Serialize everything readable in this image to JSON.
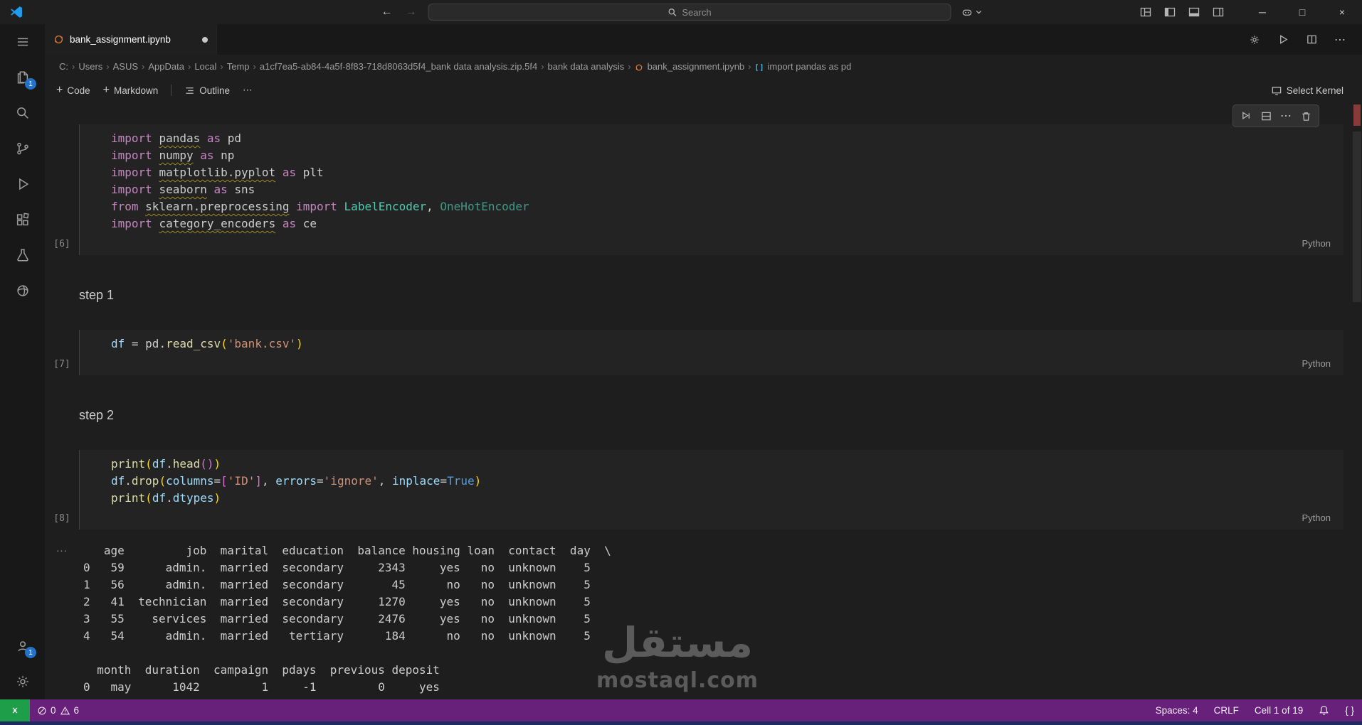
{
  "colors": {
    "statusbar": "#68217a",
    "remote": "#1f9e4a",
    "badge": "#2472c8",
    "taskstrip": "#1e2b5e"
  },
  "icons": {
    "plus": "+",
    "ellipsis": "⋯",
    "dot": "●",
    "minimize": "─",
    "maximize": "□",
    "close": "×",
    "back": "←",
    "forward": "→",
    "output_collapse": "...",
    "braces": "{ }"
  },
  "titlebar": {
    "search": "Search"
  },
  "tab": {
    "label": "bank_assignment.ipynb"
  },
  "breadcrumbs": [
    "C:",
    "Users",
    "ASUS",
    "AppData",
    "Local",
    "Temp",
    "a1cf7ea5-ab84-4a5f-8f83-718d8063d5f4_bank data analysis.zip.5f4",
    "bank data analysis",
    "bank_assignment.ipynb",
    "import pandas as pd"
  ],
  "notebook_toolbar": {
    "add_code": "Code",
    "add_markdown": "Markdown",
    "outline": "Outline",
    "select_kernel": "Select Kernel"
  },
  "activitybar": {
    "explorer_badge": "1",
    "accounts_badge": "1"
  },
  "notebook": {
    "cells": [
      {
        "type": "code",
        "exec": "[6]",
        "lang": "Python",
        "lines": [
          [
            {
              "t": "import",
              "c": "kw"
            },
            {
              "t": " ",
              "c": "pl"
            },
            {
              "t": "pandas",
              "c": "pl sq"
            },
            {
              "t": " ",
              "c": "pl"
            },
            {
              "t": "as",
              "c": "kw"
            },
            {
              "t": " pd",
              "c": "pl"
            }
          ],
          [
            {
              "t": "import",
              "c": "kw"
            },
            {
              "t": " ",
              "c": "pl"
            },
            {
              "t": "numpy",
              "c": "pl sq"
            },
            {
              "t": " ",
              "c": "pl"
            },
            {
              "t": "as",
              "c": "kw"
            },
            {
              "t": " np",
              "c": "pl"
            }
          ],
          [
            {
              "t": "import",
              "c": "kw"
            },
            {
              "t": " ",
              "c": "pl"
            },
            {
              "t": "matplotlib.pyplot",
              "c": "pl sq"
            },
            {
              "t": " ",
              "c": "pl"
            },
            {
              "t": "as",
              "c": "kw"
            },
            {
              "t": " plt",
              "c": "pl"
            }
          ],
          [
            {
              "t": "import",
              "c": "kw"
            },
            {
              "t": " ",
              "c": "pl"
            },
            {
              "t": "seaborn",
              "c": "pl sq"
            },
            {
              "t": " ",
              "c": "pl"
            },
            {
              "t": "as",
              "c": "kw"
            },
            {
              "t": " sns",
              "c": "pl"
            }
          ],
          [
            {
              "t": "from",
              "c": "kw"
            },
            {
              "t": " ",
              "c": "pl"
            },
            {
              "t": "sklearn.preprocessing",
              "c": "pl sq"
            },
            {
              "t": " ",
              "c": "pl"
            },
            {
              "t": "import",
              "c": "kw"
            },
            {
              "t": " ",
              "c": "pl"
            },
            {
              "t": "LabelEncoder",
              "c": "cls"
            },
            {
              "t": ", ",
              "c": "pl"
            },
            {
              "t": "OneHotEncoder",
              "c": "cls dim"
            }
          ],
          [
            {
              "t": "import",
              "c": "kw"
            },
            {
              "t": " ",
              "c": "pl"
            },
            {
              "t": "category_encoders",
              "c": "pl sq"
            },
            {
              "t": " ",
              "c": "pl"
            },
            {
              "t": "as",
              "c": "kw"
            },
            {
              "t": " ce",
              "c": "pl"
            }
          ]
        ]
      },
      {
        "type": "markdown",
        "text": "step 1"
      },
      {
        "type": "code",
        "exec": "[7]",
        "lang": "Python",
        "lines": [
          [
            {
              "t": "df",
              "c": "var"
            },
            {
              "t": " = ",
              "c": "pl"
            },
            {
              "t": "pd",
              "c": "pl"
            },
            {
              "t": ".",
              "c": "pl"
            },
            {
              "t": "read_csv",
              "c": "fn"
            },
            {
              "t": "(",
              "c": "b1"
            },
            {
              "t": "'bank.csv'",
              "c": "str"
            },
            {
              "t": ")",
              "c": "b1"
            }
          ]
        ]
      },
      {
        "type": "markdown",
        "text": "step 2"
      },
      {
        "type": "code",
        "exec": "[8]",
        "lang": "Python",
        "lines": [
          [
            {
              "t": "print",
              "c": "fn"
            },
            {
              "t": "(",
              "c": "b1"
            },
            {
              "t": "df",
              "c": "var"
            },
            {
              "t": ".",
              "c": "pl"
            },
            {
              "t": "head",
              "c": "fn"
            },
            {
              "t": "(",
              "c": "b2"
            },
            {
              "t": ")",
              "c": "b2"
            },
            {
              "t": ")",
              "c": "b1"
            }
          ],
          [
            {
              "t": "df",
              "c": "var"
            },
            {
              "t": ".",
              "c": "pl"
            },
            {
              "t": "drop",
              "c": "fn"
            },
            {
              "t": "(",
              "c": "b1"
            },
            {
              "t": "columns",
              "c": "param"
            },
            {
              "t": "=",
              "c": "pl"
            },
            {
              "t": "[",
              "c": "b2"
            },
            {
              "t": "'ID'",
              "c": "str"
            },
            {
              "t": "]",
              "c": "b2"
            },
            {
              "t": ", ",
              "c": "pl"
            },
            {
              "t": "errors",
              "c": "param"
            },
            {
              "t": "=",
              "c": "pl"
            },
            {
              "t": "'ignore'",
              "c": "str"
            },
            {
              "t": ", ",
              "c": "pl"
            },
            {
              "t": "inplace",
              "c": "param"
            },
            {
              "t": "=",
              "c": "pl"
            },
            {
              "t": "True",
              "c": "kb"
            },
            {
              "t": ")",
              "c": "b1"
            }
          ],
          [
            {
              "t": "print",
              "c": "fn"
            },
            {
              "t": "(",
              "c": "b1"
            },
            {
              "t": "df",
              "c": "var"
            },
            {
              "t": ".",
              "c": "pl"
            },
            {
              "t": "dtypes",
              "c": "var"
            },
            {
              "t": ")",
              "c": "b1"
            }
          ]
        ]
      },
      {
        "type": "output",
        "gutter": "...",
        "lines": [
          "   age         job  marital  education  balance housing loan  contact  day  \\",
          "0   59      admin.  married  secondary     2343     yes   no  unknown    5",
          "1   56      admin.  married  secondary       45      no   no  unknown    5",
          "2   41  technician  married  secondary     1270     yes   no  unknown    5",
          "3   55    services  married  secondary     2476     yes   no  unknown    5",
          "4   54      admin.  married   tertiary      184      no   no  unknown    5",
          "",
          "  month  duration  campaign  pdays  previous deposit",
          "0   may      1042         1     -1         0     yes"
        ]
      }
    ]
  },
  "watermark": {
    "arabic": "مستقل",
    "latin": "mostaql.com"
  },
  "statusbar": {
    "errors": "0",
    "warnings": "6",
    "spaces": "Spaces: 4",
    "eol": "CRLF",
    "cell": "Cell 1 of 19"
  }
}
